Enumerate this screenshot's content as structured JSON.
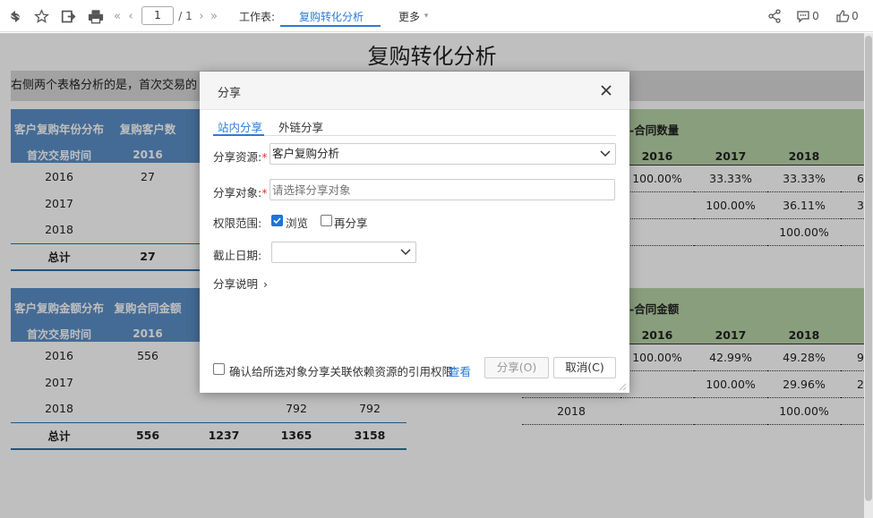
{
  "toolbar": {
    "page_current": "1",
    "page_total": "/ 1",
    "worksheet_label": "工作表:",
    "active_sheet": "复购转化分析",
    "more_label": "更多",
    "comment_count": "0",
    "like_count": "0",
    "accent": "#2d7bd6"
  },
  "report": {
    "title": "复购转化分析",
    "description": "右侧两个表格分析的是，首次交易的",
    "table1": {
      "header": [
        "客户复购年份分布",
        "复购客户数"
      ],
      "subheader": [
        "首次交易时间",
        "2016"
      ],
      "rows": [
        [
          "2016",
          "27"
        ],
        [
          "2017",
          ""
        ],
        [
          "2018",
          ""
        ]
      ],
      "total": [
        "总计",
        "27"
      ]
    },
    "table2": {
      "header": [
        "客户复购金额分布",
        "复购合同金额"
      ],
      "subheader": [
        "首次交易时间",
        "2016"
      ],
      "rows": [
        [
          "2016",
          "556",
          "",
          "",
          ""
        ],
        [
          "2017",
          "",
          "",
          "",
          ""
        ],
        [
          "2018",
          "",
          "",
          "792",
          "792"
        ]
      ],
      "total": [
        "总计",
        "556",
        "1237",
        "1365",
        "3158"
      ]
    },
    "gtable1": {
      "title": "-合同数量",
      "years": [
        "2016",
        "2017",
        "2018"
      ],
      "rows": [
        [
          "100.00%",
          "33.33%",
          "33.33%",
          "6"
        ],
        [
          "",
          "100.00%",
          "36.11%",
          "3"
        ],
        [
          "",
          "",
          "100.00%",
          ""
        ]
      ]
    },
    "gtable2": {
      "title": "-合同金额",
      "years": [
        "2016",
        "2017",
        "2018"
      ],
      "rows": [
        [
          "",
          "100.00%",
          "42.99%",
          "49.28%",
          "9"
        ],
        [
          "",
          "",
          "100.00%",
          "29.96%",
          "2"
        ],
        [
          "2018",
          "",
          "",
          "100.00%",
          ""
        ]
      ]
    }
  },
  "dialog": {
    "title": "分享",
    "tabs": [
      "站内分享",
      "外链分享"
    ],
    "resource_label": "分享资源:",
    "resource_value": "客户复购分析",
    "target_label": "分享对象:",
    "target_placeholder": "请选择分享对象",
    "perm_label": "权限范围:",
    "perm_browse": "浏览",
    "perm_reshare": "再分享",
    "deadline_label": "截止日期:",
    "note_label": "分享说明",
    "confirm_text": "确认给所选对象分享关联依赖资源的引用权限",
    "view_link": "查看",
    "share_button": "分享(O)",
    "cancel_button": "取消(C)"
  }
}
